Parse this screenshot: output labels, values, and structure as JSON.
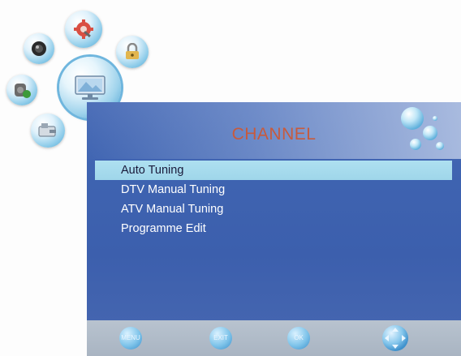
{
  "panel": {
    "title": "CHANNEL"
  },
  "menu": {
    "items": [
      {
        "label": "Auto Tuning",
        "selected": true
      },
      {
        "label": "DTV Manual Tuning",
        "selected": false
      },
      {
        "label": "ATV Manual Tuning",
        "selected": false
      },
      {
        "label": "Programme Edit",
        "selected": false
      }
    ]
  },
  "bubbles": [
    {
      "name": "picture-menu-icon"
    },
    {
      "name": "setup-menu-icon"
    },
    {
      "name": "lock-menu-icon"
    },
    {
      "name": "channel-menu-icon"
    },
    {
      "name": "sound-menu-icon"
    },
    {
      "name": "usb-menu-icon"
    }
  ],
  "bottom_bar": {
    "hints": [
      {
        "icon": "menu-key-icon",
        "label": "MENU"
      },
      {
        "icon": "exit-key-icon",
        "label": "EXIT"
      },
      {
        "icon": "ok-key-icon",
        "label": "OK"
      },
      {
        "icon": "direction-keys-icon",
        "label": ""
      }
    ]
  },
  "colors": {
    "panel_blue": "#3f64b1",
    "title_red": "#c85a3c",
    "highlight": "#a6dbee"
  }
}
